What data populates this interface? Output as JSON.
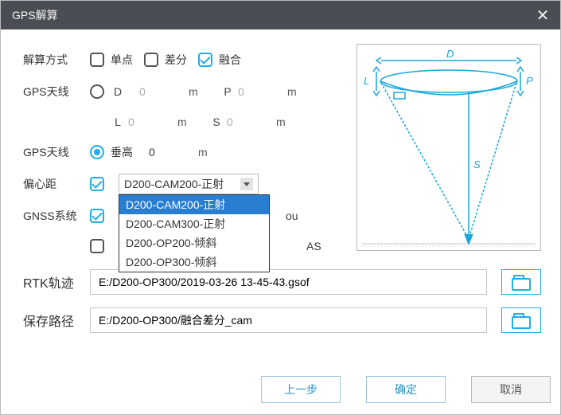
{
  "dialog_title": "GPS解算",
  "labels": {
    "calc_mode": "解算方式",
    "antenna_dims": "GPS天线",
    "antenna_height": "GPS天线",
    "eccentric": "偏心距",
    "gnss": "GNSS系统",
    "rtk_path": "RTK轨迹",
    "save_path": "保存路径"
  },
  "calc_mode": {
    "single": "单点",
    "diff": "差分",
    "fusion": "融合"
  },
  "antenna": {
    "d_opt": "D",
    "d_val": "0",
    "p_label": "P",
    "p_val": "0",
    "l_label": "L",
    "l_val": "0",
    "s_label": "S",
    "s_val": "0",
    "vertical": "垂高",
    "v_val": "0",
    "unit": "m"
  },
  "eccentric": {
    "selected": "D200-CAM200-正射",
    "options": [
      "D200-CAM200-正射",
      "D200-CAM300-正射",
      "D200-OP200-倾斜",
      "D200-OP300-倾斜"
    ]
  },
  "gnss": {
    "tail1": "ou",
    "tail2": "AS"
  },
  "rtk_path_val": "E:/D200-OP300/2019-03-26 13-45-43.gsof",
  "save_path_val": "E:/D200-OP300/融合差分_cam",
  "buttons": {
    "prev": "上一步",
    "ok": "确定",
    "cancel": "取消"
  },
  "diagram_labels": {
    "D": "D",
    "L": "L",
    "P": "P",
    "S": "S"
  }
}
